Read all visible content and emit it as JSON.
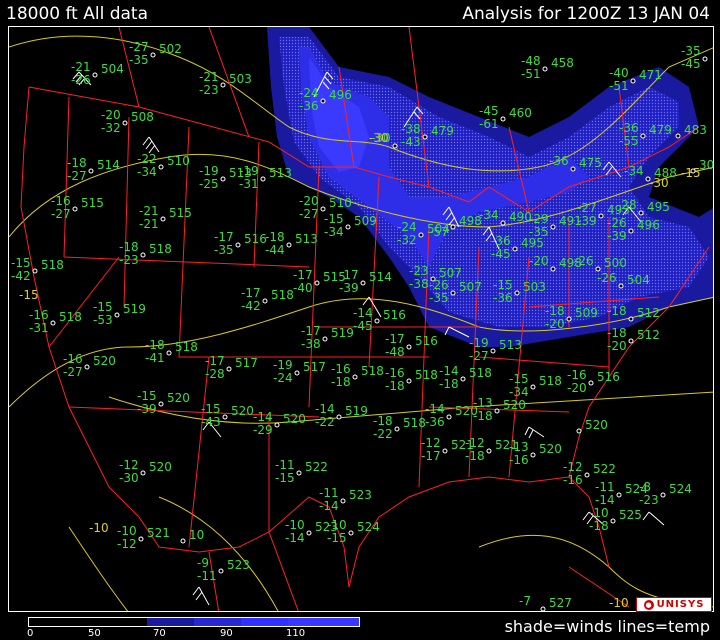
{
  "header": {
    "title_left": "18000 ft All data",
    "title_right": "Analysis for 1200Z 13 JAN 04"
  },
  "colors": {
    "background": "#000000",
    "border_lines": "#ff2020",
    "isotherm_lines": "#d8c820",
    "station_text": "#3fdc3f",
    "wind_shade_50": "#000000",
    "wind_shade_70": "#1a1aa0",
    "wind_shade_90": "#2828d0",
    "wind_shade_110": "#3030ff"
  },
  "legend": {
    "ticks": [
      "0",
      "50",
      "70",
      "90",
      "110"
    ],
    "caption": "shade=winds lines=temp"
  },
  "logo": {
    "text": "UNISYS",
    "icon": "unisys-logo-icon"
  },
  "isotherm_labels": [
    "-30",
    "-30",
    "-15",
    "-15",
    "-10",
    "-10"
  ],
  "stations": [
    {
      "t": "-27",
      "d": "-35",
      "h": "502"
    },
    {
      "t": "-21",
      "d": "-26",
      "h": "504"
    },
    {
      "t": "-21",
      "d": "-23",
      "h": "503"
    },
    {
      "t": "-24",
      "d": "-36",
      "h": "496"
    },
    {
      "t": "-20",
      "d": "-32",
      "h": "508"
    },
    {
      "t": "-30",
      "d": "",
      "h": ""
    },
    {
      "t": "-38",
      "d": "-43",
      "h": "479"
    },
    {
      "t": "-48",
      "d": "-51",
      "h": "458"
    },
    {
      "t": "-40",
      "d": "-51",
      "h": "471"
    },
    {
      "t": "-35",
      "d": "-45",
      "h": ""
    },
    {
      "t": "-45",
      "d": "-61",
      "h": "460"
    },
    {
      "t": "-22",
      "d": "-34",
      "h": "510"
    },
    {
      "t": "-18",
      "d": "-27",
      "h": "514"
    },
    {
      "t": "-19",
      "d": "-25",
      "h": "513"
    },
    {
      "t": "-19",
      "d": "-31",
      "h": "513"
    },
    {
      "t": "-36",
      "d": "-55",
      "h": "479"
    },
    {
      "t": "",
      "d": "",
      "h": "483"
    },
    {
      "t": "-36",
      "d": "",
      "h": "475"
    },
    {
      "t": "-34",
      "d": "",
      "h": "488"
    },
    {
      "t": "",
      "d": "",
      "h": "30"
    },
    {
      "t": "-16",
      "d": "-27",
      "h": "515"
    },
    {
      "t": "-21",
      "d": "-21",
      "h": "515"
    },
    {
      "t": "-20",
      "d": "-27",
      "h": "510"
    },
    {
      "t": "-15",
      "d": "-34",
      "h": "509"
    },
    {
      "t": "-24",
      "d": "-32",
      "h": "504"
    },
    {
      "t": "",
      "d": "-57",
      "h": "498"
    },
    {
      "t": "-34",
      "d": "",
      "h": "490"
    },
    {
      "t": "-29",
      "d": "-35",
      "h": "491"
    },
    {
      "t": "-27",
      "d": "-39",
      "h": "493"
    },
    {
      "t": "-28",
      "d": "",
      "h": "495"
    },
    {
      "t": "-26",
      "d": "-39",
      "h": "496"
    },
    {
      "t": "-18",
      "d": "-23",
      "h": "518"
    },
    {
      "t": "-17",
      "d": "-35",
      "h": "516"
    },
    {
      "t": "-18",
      "d": "-44",
      "h": "513"
    },
    {
      "t": "-36",
      "d": "-45",
      "h": "495"
    },
    {
      "t": "-15",
      "d": "-42",
      "h": "518"
    },
    {
      "t": "-17",
      "d": "-40",
      "h": "515"
    },
    {
      "t": "-17",
      "d": "-39",
      "h": "514"
    },
    {
      "t": "-23",
      "d": "-38",
      "h": "507"
    },
    {
      "t": "-26",
      "d": "-35",
      "h": "507"
    },
    {
      "t": "-20",
      "d": "",
      "h": "498"
    },
    {
      "t": "-26",
      "d": "",
      "h": "500"
    },
    {
      "t": "-26",
      "d": "",
      "h": "504"
    },
    {
      "t": "-15",
      "d": "-36",
      "h": "503"
    },
    {
      "t": "-17",
      "d": "-42",
      "h": "518"
    },
    {
      "t": "-16",
      "d": "-31",
      "h": "518"
    },
    {
      "t": "-15",
      "d": "-53",
      "h": "519"
    },
    {
      "t": "-14",
      "d": "-45",
      "h": "516"
    },
    {
      "t": "-17",
      "d": "-38",
      "h": "519"
    },
    {
      "t": "-18",
      "d": "-20",
      "h": "509"
    },
    {
      "t": "-18",
      "d": "",
      "h": "512"
    },
    {
      "t": "-17",
      "d": "-48",
      "h": "516"
    },
    {
      "t": "-18",
      "d": "-41",
      "h": "518"
    },
    {
      "t": "-19",
      "d": "-27",
      "h": "513"
    },
    {
      "t": "-18",
      "d": "-20",
      "h": "512"
    },
    {
      "t": "-16",
      "d": "-27",
      "h": "520"
    },
    {
      "t": "-17",
      "d": "-28",
      "h": "517"
    },
    {
      "t": "-19",
      "d": "-24",
      "h": "517"
    },
    {
      "t": "-16",
      "d": "-18",
      "h": "518"
    },
    {
      "t": "-16",
      "d": "-18",
      "h": "518"
    },
    {
      "t": "-14",
      "d": "-18",
      "h": "518"
    },
    {
      "t": "-15",
      "d": "-34",
      "h": "518"
    },
    {
      "t": "-16",
      "d": "-20",
      "h": "516"
    },
    {
      "t": "-15",
      "d": "-39",
      "h": "520"
    },
    {
      "t": "-15",
      "d": "-43",
      "h": "520"
    },
    {
      "t": "-14",
      "d": "-29",
      "h": "520"
    },
    {
      "t": "-14",
      "d": "-22",
      "h": "519"
    },
    {
      "t": "-18",
      "d": "-22",
      "h": "518"
    },
    {
      "t": "-14",
      "d": "-36",
      "h": "520"
    },
    {
      "t": "-13",
      "d": "-18",
      "h": "520"
    },
    {
      "t": "-12",
      "d": "-17",
      "h": "521"
    },
    {
      "t": "-12",
      "d": "-18",
      "h": "521"
    },
    {
      "t": "-13",
      "d": "-16",
      "h": "520"
    },
    {
      "t": "",
      "d": "",
      "h": "520"
    },
    {
      "t": "-12",
      "d": "-30",
      "h": "520"
    },
    {
      "t": "-11",
      "d": "-15",
      "h": "522"
    },
    {
      "t": "-12",
      "d": "-16",
      "h": "522"
    },
    {
      "t": "-11",
      "d": "-14",
      "h": "523"
    },
    {
      "t": "-11",
      "d": "-14",
      "h": "524"
    },
    {
      "t": "-8",
      "d": "-23",
      "h": "524"
    },
    {
      "t": "-10",
      "d": "-14",
      "h": "523"
    },
    {
      "t": "-10",
      "d": "-15",
      "h": "524"
    },
    {
      "t": "-10",
      "d": "-18",
      "h": "525"
    },
    {
      "t": "-10",
      "d": "-12",
      "h": "521"
    },
    {
      "t": "",
      "d": "",
      "h": "10"
    },
    {
      "t": "-9",
      "d": "-11",
      "h": "523"
    },
    {
      "t": "-7",
      "d": "",
      "h": "527"
    },
    {
      "t": "",
      "d": "",
      "h": "-10"
    }
  ]
}
